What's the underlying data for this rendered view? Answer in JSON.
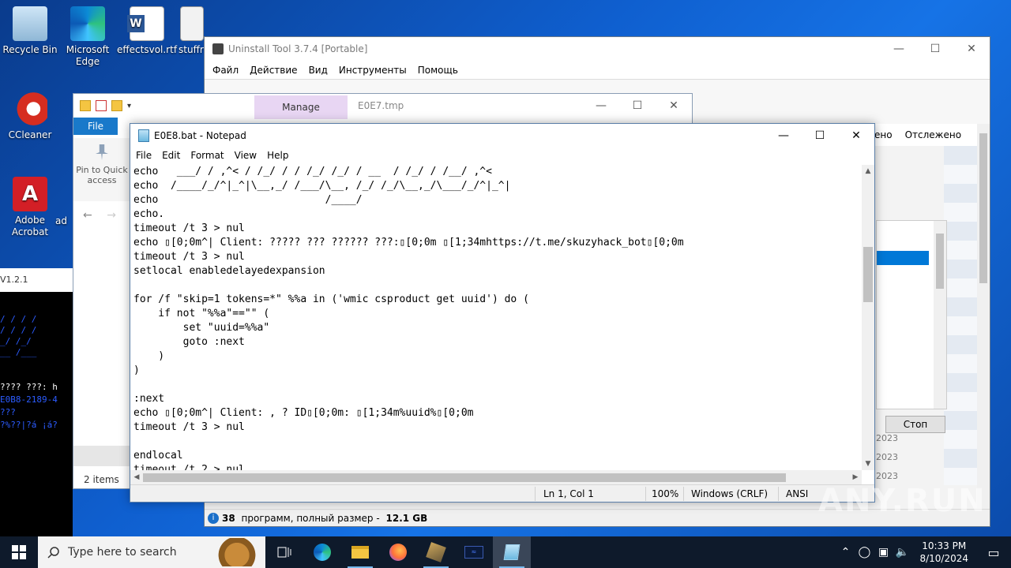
{
  "desktop": {
    "icons": [
      {
        "label": "Recycle Bin"
      },
      {
        "label": "Microsoft Edge"
      },
      {
        "label": "effectsvol.rtf"
      },
      {
        "label": "stuffr"
      },
      {
        "label": "CCleaner"
      },
      {
        "label": "Adobe Acrobat"
      },
      {
        "label": "ad"
      }
    ]
  },
  "uninstall_tool": {
    "title": "Uninstall Tool 3.7.4 [Portable]",
    "menu": [
      "Файл",
      "Действие",
      "Вид",
      "Инструменты",
      "Помощь"
    ],
    "columns": [
      "ено",
      "Отслежено"
    ],
    "stop_label": "Стоп",
    "years": [
      "2023",
      "2023",
      "2023"
    ],
    "status_count": "38",
    "status_text": " программ, полный размер - ",
    "status_size": "12.1 GB"
  },
  "explorer": {
    "manage_label": "Manage",
    "title": "E0E7.tmp",
    "file_tab": "File",
    "pin_label": "Pin to Quick access",
    "items_count": "2 items"
  },
  "console": {
    "header": "V1.2.1",
    "lines": [
      "???? ???: h",
      "E0B8-2189-4",
      "???",
      "?%??|?á  ¡á?"
    ]
  },
  "notepad": {
    "title": "E0E8.bat - Notepad",
    "menu": [
      "File",
      "Edit",
      "Format",
      "View",
      "Help"
    ],
    "lines": [
      "echo   ___/ / ,^< / /_/ / / /_/ /_/ / __  / /_/ / /__/ ,^<",
      "echo  /____/_/^|_^|\\__,_/ /___/\\__, /_/ /_/\\__,_/\\___/_/^|_^|",
      "echo                           /____/",
      "echo.",
      "timeout /t 3 > nul",
      "echo \u0000[0;0m^| Client: ????? ??? ?????? ???:\u0000[0;0m \u0000[1;34mhttps://t.me/skuzyhack_bot\u0000[0;0m",
      "timeout /t 3 > nul",
      "setlocal enabledelayedexpansion",
      "",
      "for /f \"skip=1 tokens=*\" %%a in ('wmic csproduct get uuid') do (",
      "    if not \"%%a\"==\"\" (",
      "        set \"uuid=%%a\"",
      "        goto :next",
      "    )",
      ")",
      "",
      ":next",
      "echo \u0000[0;0m^| Client: , ? ID\u0000[0;0m: \u0000[1;34m%uuid%\u0000[0;0m",
      "timeout /t 3 > nul",
      "",
      "endlocal",
      "timeout /t 2 > nul"
    ],
    "status": {
      "position": "Ln 1, Col 1",
      "zoom": "100%",
      "line_ending": "Windows (CRLF)",
      "encoding": "ANSI"
    }
  },
  "taskbar": {
    "search_placeholder": "Type here to search",
    "time": "10:33 PM",
    "date": "8/10/2024"
  },
  "watermark": "ANY.RUN"
}
